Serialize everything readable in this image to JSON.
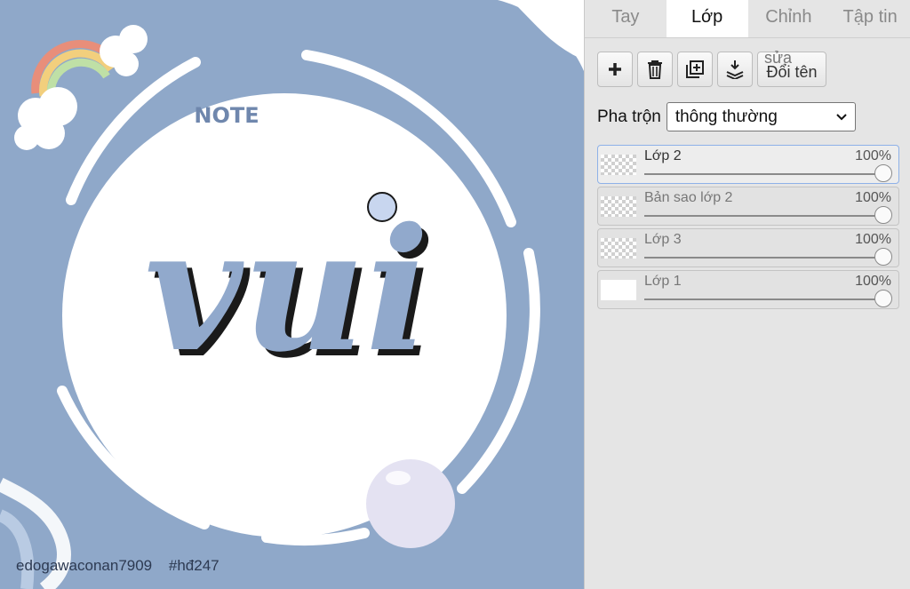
{
  "tabs": [
    {
      "label": "Tay"
    },
    {
      "label": "Lớp"
    },
    {
      "label": "Chỉnh"
    },
    {
      "label": "Tập tin"
    }
  ],
  "toolbar": {
    "add_icon": "plus-icon",
    "delete_icon": "trash-icon",
    "duplicate_icon": "duplicate-layer-icon",
    "merge_icon": "merge-down-icon",
    "rename_overlap": "sửa",
    "rename_label": "Đổi tên"
  },
  "blend": {
    "label": "Pha trộn",
    "value": "thông thường"
  },
  "layers": [
    {
      "name": "Lớp 2",
      "opacity": "100%",
      "opacity_value": 1.0
    },
    {
      "name": "Bản sao lớp 2",
      "opacity": "100%",
      "opacity_value": 1.0
    },
    {
      "name": "Lớp 3",
      "opacity": "100%",
      "opacity_value": 1.0
    },
    {
      "name": "Lớp 1",
      "opacity": "100%",
      "opacity_value": 1.0
    }
  ],
  "canvas": {
    "note_text": "NOTE",
    "big_word": "vui",
    "caption_user": "edogawaconan7909",
    "caption_tag": "#hđ247",
    "background_color": "#8fa8c9",
    "accent_color": "#8eb1e8"
  }
}
